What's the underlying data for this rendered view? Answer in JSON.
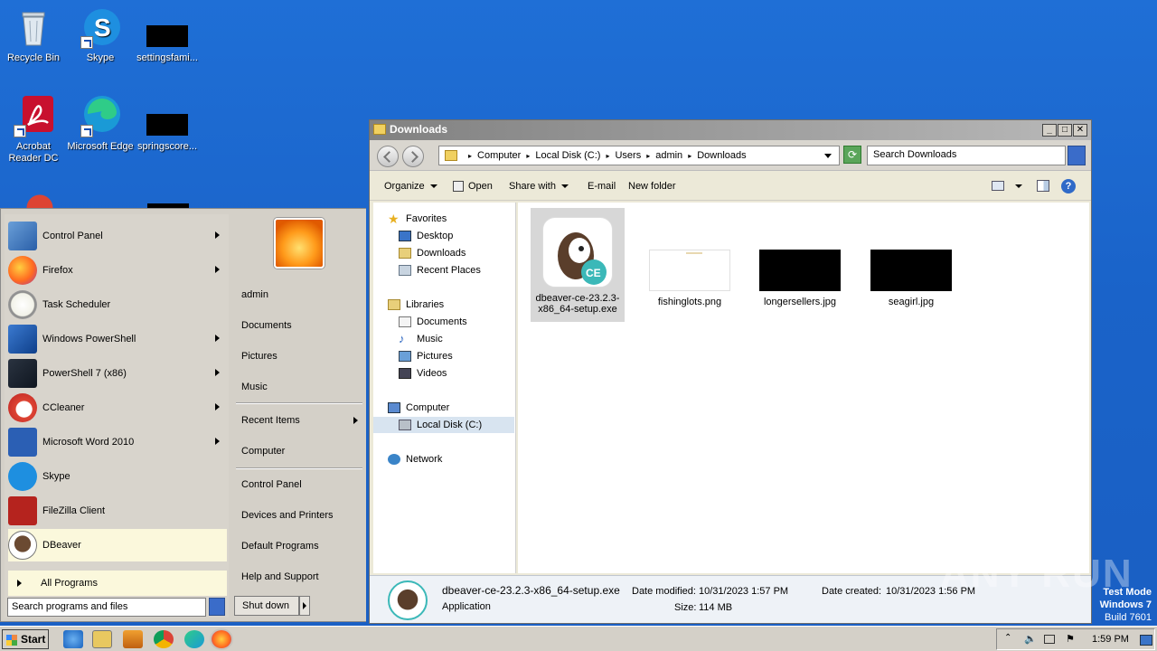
{
  "desktop": {
    "icons": [
      {
        "label": "Recycle Bin",
        "icon": "recycle-bin-icon"
      },
      {
        "label": "Skype",
        "icon": "skype-icon"
      },
      {
        "label": "settingsfami...",
        "icon": "file-thumb-icon"
      },
      {
        "label": "Acrobat Reader DC",
        "icon": "acrobat-icon"
      },
      {
        "label": "Microsoft Edge",
        "icon": "edge-icon"
      },
      {
        "label": "springscore...",
        "icon": "file-thumb-icon"
      }
    ]
  },
  "start_menu": {
    "programs": [
      {
        "label": "Control Panel",
        "icon": "control-panel-icon",
        "has_submenu": true
      },
      {
        "label": "Firefox",
        "icon": "firefox-icon",
        "has_submenu": true
      },
      {
        "label": "Task Scheduler",
        "icon": "task-scheduler-icon",
        "has_submenu": false
      },
      {
        "label": "Windows PowerShell",
        "icon": "powershell-icon",
        "has_submenu": true
      },
      {
        "label": "PowerShell 7 (x86)",
        "icon": "powershell7-icon",
        "has_submenu": true
      },
      {
        "label": "CCleaner",
        "icon": "ccleaner-icon",
        "has_submenu": true
      },
      {
        "label": "Microsoft Word 2010",
        "icon": "word-icon",
        "has_submenu": true
      },
      {
        "label": "Skype",
        "icon": "skype-icon",
        "has_submenu": false
      },
      {
        "label": "FileZilla Client",
        "icon": "filezilla-icon",
        "has_submenu": false
      },
      {
        "label": "DBeaver",
        "icon": "dbeaver-icon",
        "has_submenu": false
      }
    ],
    "all_programs": "All Programs",
    "search_placeholder": "Search programs and files",
    "right": {
      "user": "admin",
      "documents": "Documents",
      "pictures": "Pictures",
      "music": "Music",
      "recent_items": "Recent Items",
      "computer": "Computer",
      "control_panel": "Control Panel",
      "devices": "Devices and Printers",
      "default_programs": "Default Programs",
      "help": "Help and Support"
    },
    "shutdown": "Shut down"
  },
  "explorer": {
    "title": "Downloads",
    "breadcrumb": [
      "Computer",
      "Local Disk (C:)",
      "Users",
      "admin",
      "Downloads"
    ],
    "search_placeholder": "Search Downloads",
    "toolbar": {
      "organize": "Organize",
      "open": "Open",
      "share_with": "Share with",
      "email": "E-mail",
      "new_folder": "New folder"
    },
    "nav": {
      "favorites": "Favorites",
      "desktop": "Desktop",
      "downloads": "Downloads",
      "recent_places": "Recent Places",
      "libraries": "Libraries",
      "documents": "Documents",
      "music": "Music",
      "pictures": "Pictures",
      "videos": "Videos",
      "computer": "Computer",
      "local_disk": "Local Disk (C:)",
      "network": "Network"
    },
    "files": [
      {
        "name": "dbeaver-ce-23.2.3-x86_64-setup.exe",
        "type": "exe"
      },
      {
        "name": "fishinglots.png",
        "type": "png"
      },
      {
        "name": "longersellers.jpg",
        "type": "jpg"
      },
      {
        "name": "seagirl.jpg",
        "type": "jpg"
      }
    ],
    "details": {
      "name": "dbeaver-ce-23.2.3-x86_64-setup.exe",
      "type": "Application",
      "modified_label": "Date modified:",
      "modified": "10/31/2023 1:57 PM",
      "created_label": "Date created:",
      "created": "10/31/2023 1:56 PM",
      "size_label": "Size:",
      "size": "114 MB"
    }
  },
  "taskbar": {
    "start": "Start",
    "clock": "1:59 PM"
  },
  "watermark": "ANY RUN",
  "test_mode": {
    "line1": "Test Mode",
    "line2": "Windows 7",
    "line3": "Build 7601"
  },
  "colors": {
    "desktop_bg": "#1f6fd6",
    "selection": "#fbf8dc",
    "dbeaver_teal": "#3bb8b8"
  }
}
